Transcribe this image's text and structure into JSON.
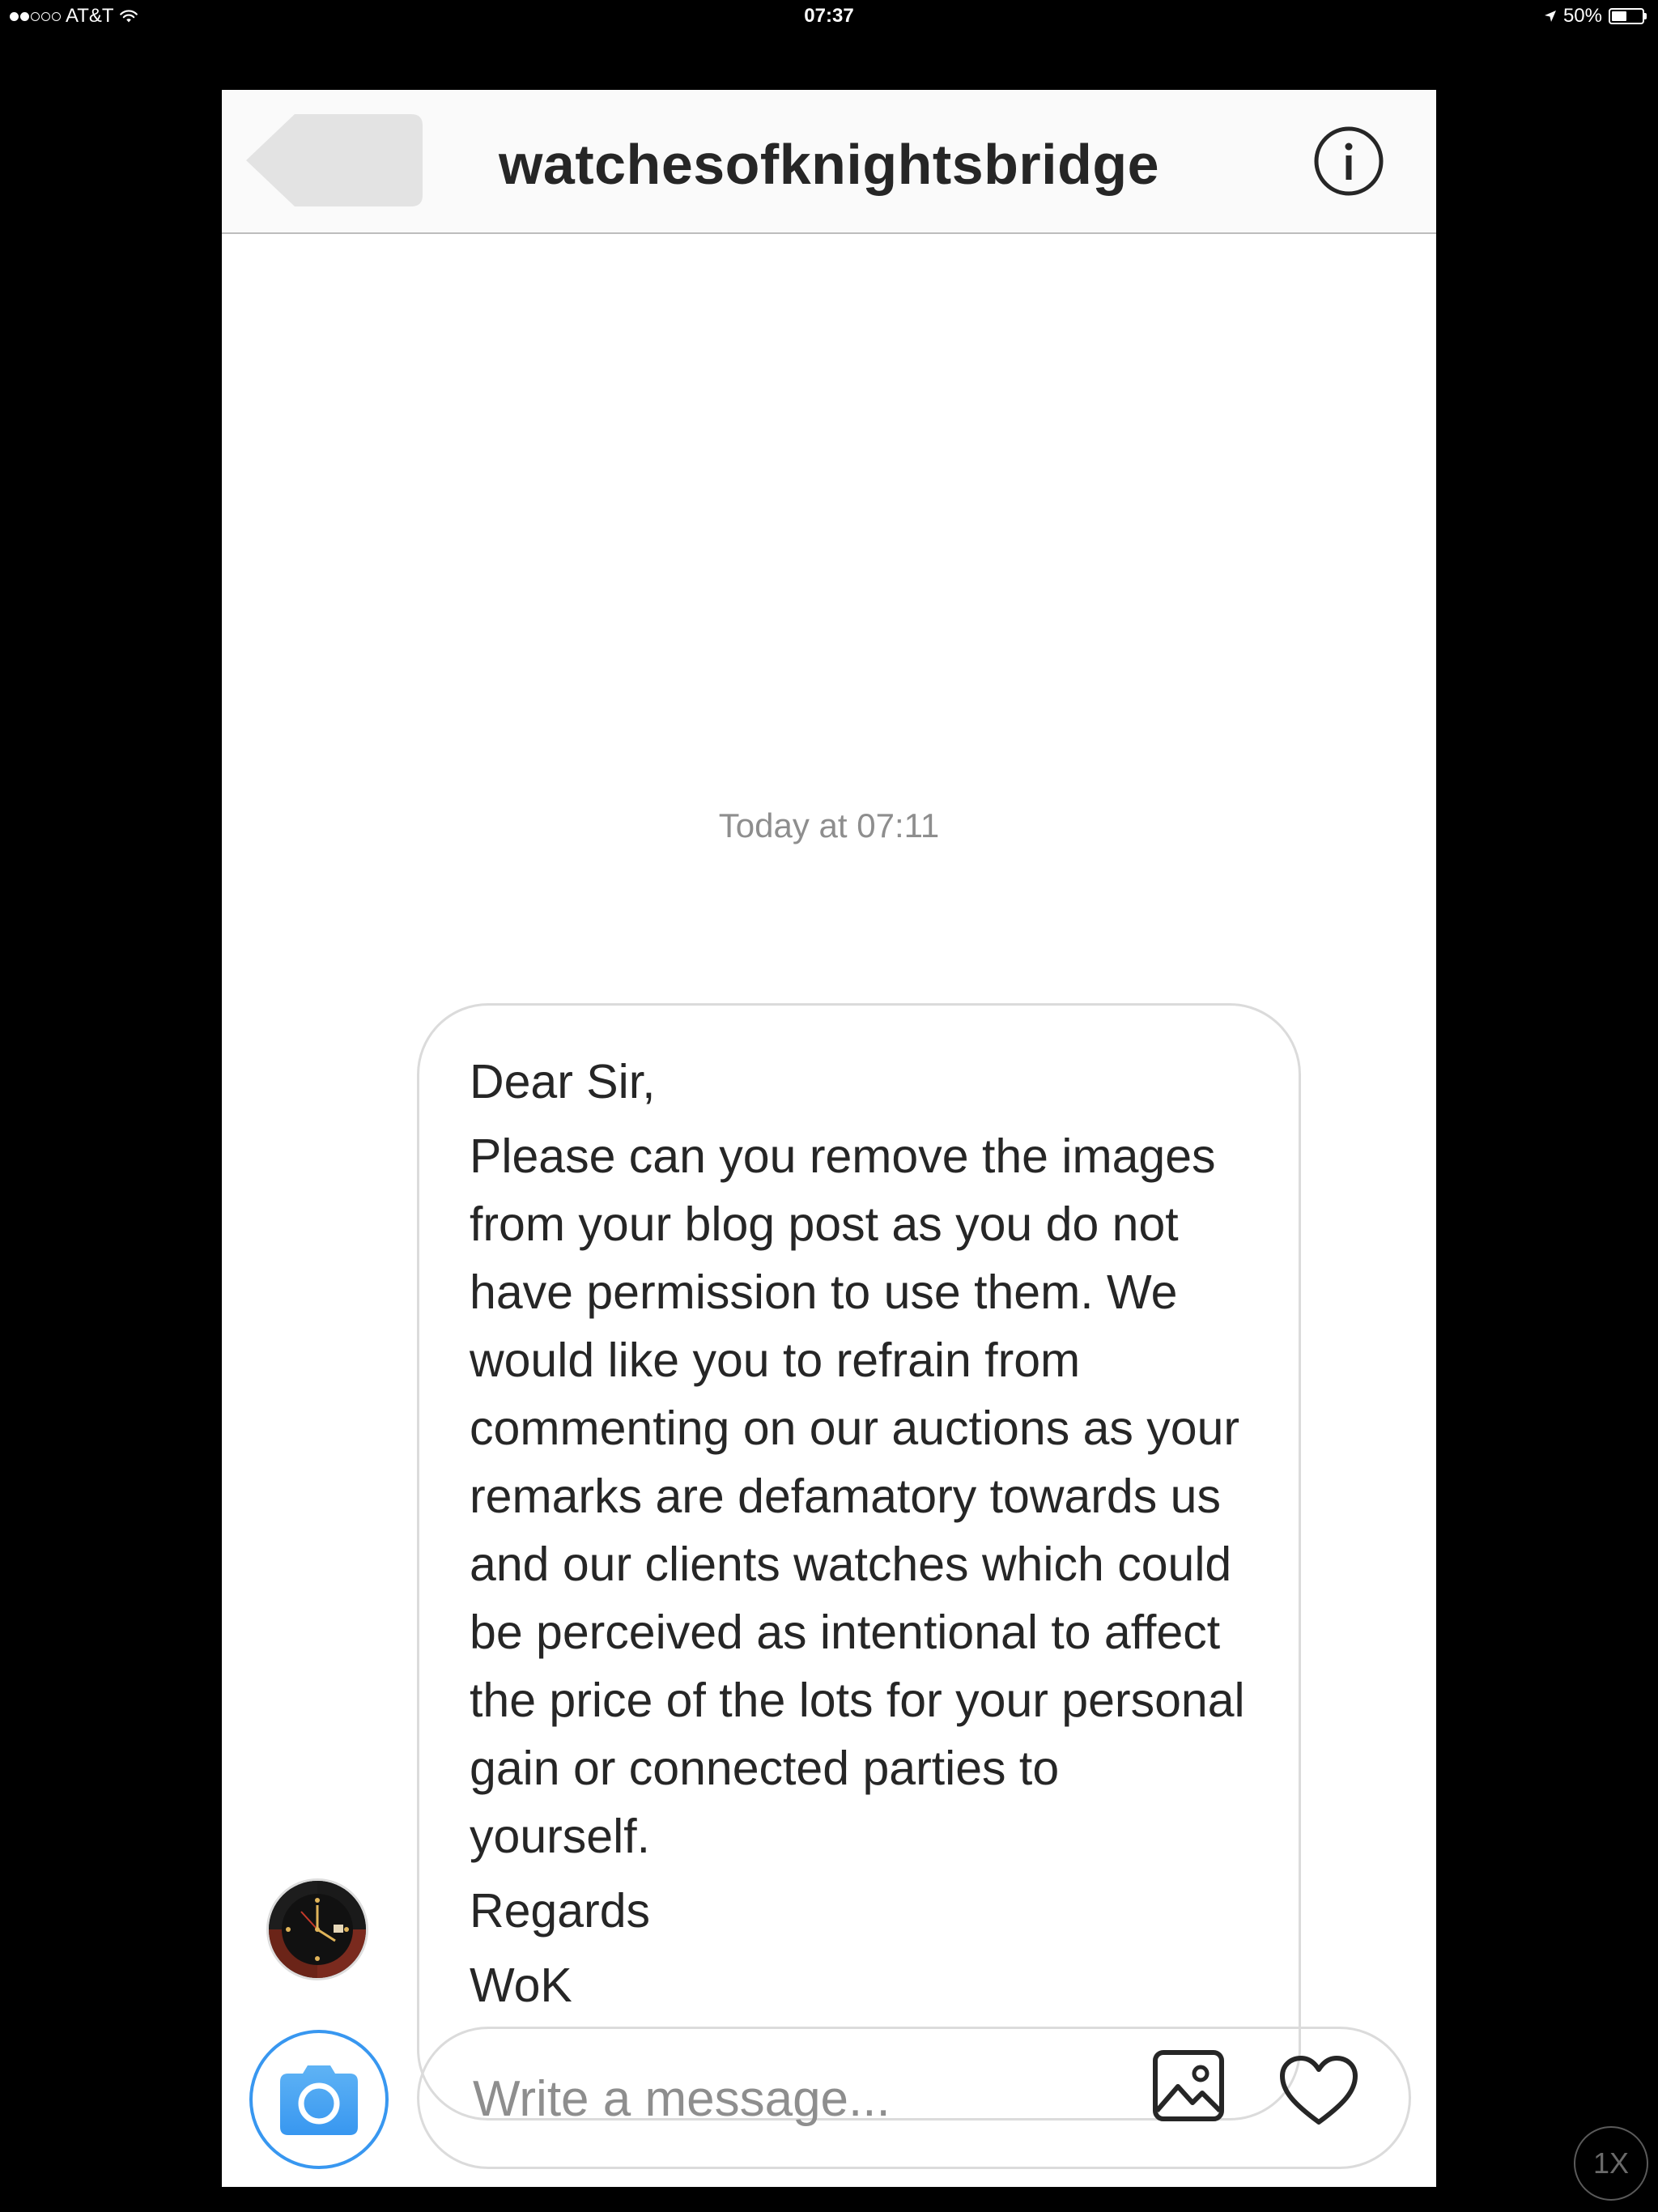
{
  "status_bar": {
    "carrier": "AT&T",
    "time": "07:37",
    "battery_percent": "50%",
    "battery_level": 0.5,
    "signal_bars_filled": 2,
    "signal_bars_total": 5,
    "icons": [
      "wifi-icon",
      "location-arrow-icon",
      "battery-icon"
    ]
  },
  "header": {
    "title": "watchesofknightsbridge",
    "back_icon": "back-arrow-icon",
    "info_icon": "info-icon"
  },
  "thread": {
    "timestamp": "Today at 07:11",
    "message": {
      "greeting": "Dear Sir,",
      "body": "Please can you remove the images from your blog post as you do not have permission to use them. We would like you to refrain from commenting on our auctions as your remarks are defamatory towards us and our clients watches which could be perceived as intentional to affect the price of the lots for your personal gain or connected parties to yourself.",
      "signoff": "Regards",
      "signature": "WoK"
    }
  },
  "composer": {
    "placeholder": "Write a message...",
    "value": "",
    "camera_icon": "camera-icon",
    "gallery_icon": "image-gallery-icon",
    "like_icon": "heart-icon"
  },
  "zoom_badge": "1X",
  "colors": {
    "accent_blue": "#3897f0",
    "text_primary": "#262626",
    "text_secondary": "#8e8e8e",
    "border": "#dbdbdb"
  }
}
